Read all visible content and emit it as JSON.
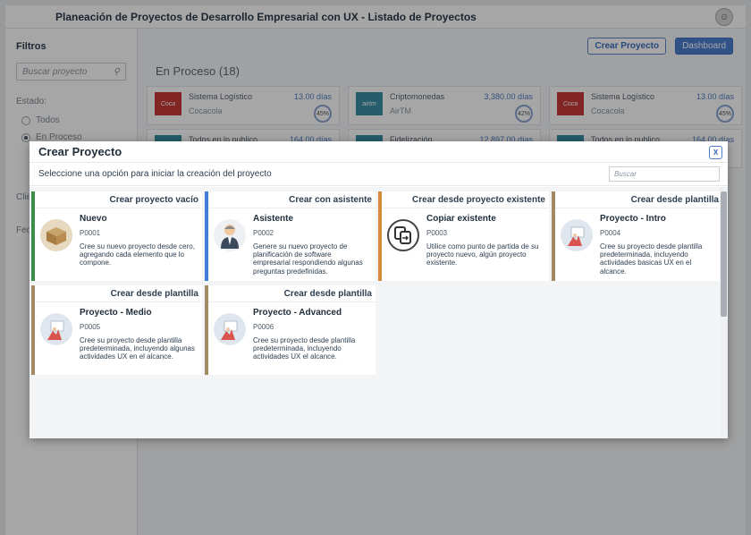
{
  "app": {
    "title": "Planeación de Proyectos de Desarrollo Empresarial con UX - Listado de Proyectos"
  },
  "sidebar": {
    "heading": "Filtros",
    "search_placeholder": "Buscar proyecto",
    "estado_label": "Estado:",
    "options": [
      "Todos",
      "En Proceso"
    ],
    "cli_label": "Clie",
    "fec_label": "Fech"
  },
  "main": {
    "create_button": "Crear Proyecto",
    "dashboard_button": "Dashboard",
    "section_title": "En Proceso (18)",
    "projects": [
      {
        "name": "Sistema Logístico",
        "client": "Cocacola",
        "days": "13.00 días",
        "pct": "45%"
      },
      {
        "name": "Criptomonedas",
        "client": "AirTM",
        "days": "3,380.00 días",
        "pct": "42%"
      },
      {
        "name": "Sistema Logístico",
        "client": "Cocacola",
        "days": "13.00 días",
        "pct": "45%"
      },
      {
        "name": "Todos en lo publico",
        "client": "",
        "days": "164.00 días",
        "pct": ""
      },
      {
        "name": "Fidelización",
        "client": "",
        "days": "12,897.00 días",
        "pct": ""
      },
      {
        "name": "Todos en lo publico",
        "client": "",
        "days": "164.00 días",
        "pct": ""
      }
    ]
  },
  "modal": {
    "title": "Crear Proyecto",
    "close_label": "X",
    "description": "Seleccione una opción para iniciar la creación del proyecto",
    "search_placeholder": "Buscar",
    "options": [
      {
        "header": "Crear proyecto vacío",
        "name": "Nuevo",
        "code": "P0001",
        "desc": "Cree su nuevo proyecto desde cero, agregando cada elemento que lo compone.",
        "icon": "box-icon",
        "color": "#3a8f48"
      },
      {
        "header": "Crear con asistente",
        "name": "Asistente",
        "code": "P0002",
        "desc": "Genere su nuevo proyecto de planificación de software empresarial respondiendo algunas preguntas predefinidas.",
        "icon": "assistant-icon",
        "color": "#3f7fd9"
      },
      {
        "header": "Crear desde proyecto existente",
        "name": "Copiar existente",
        "code": "P0003",
        "desc": "Utilice como punto de partida de su proyecto nuevo, algún proyecto existente.",
        "icon": "copy-icon",
        "color": "#d58a3c"
      },
      {
        "header": "Crear desde plantilla",
        "name": "Proyecto - Intro",
        "code": "P0004",
        "desc": "Cree su proyecto desde plantilla predeterminada, incluyendo actividades basicas UX en el alcance.",
        "icon": "template-icon",
        "color": "#a48a64"
      },
      {
        "header": "Crear desde plantilla",
        "name": "Proyecto - Medio",
        "code": "P0005",
        "desc": "Cree su proyecto desde plantilla predeterminada, incluyendo algunas actividades UX en el alcance.",
        "icon": "template-icon",
        "color": "#a48a64"
      },
      {
        "header": "Crear desde plantilla",
        "name": "Proyecto - Advanced",
        "code": "P0006",
        "desc": "Cree su proyecto desde plantilla predeterminada, incluyendo actividades UX el alcance.",
        "icon": "template-icon",
        "color": "#a48a64"
      }
    ]
  }
}
